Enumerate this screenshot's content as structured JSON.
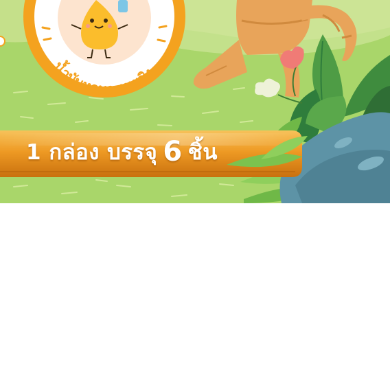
{
  "badge": {
    "curved_text": "น้ำมันหอมระเหยขิง",
    "mascot": "oil-drop-mascot-icon"
  },
  "pill": {
    "prefix": "1 กล่อง บรรจุ",
    "number": "6",
    "suffix": "ชิ้น"
  },
  "colors": {
    "grass": "#a9d66a",
    "grass_light": "#cfe69a",
    "pill_orange": "#e8921d",
    "badge_orange": "#f4a21f",
    "rock": "#5d93a6",
    "leaf_dark": "#2f7d3c",
    "leaf_light": "#7cc24e"
  }
}
